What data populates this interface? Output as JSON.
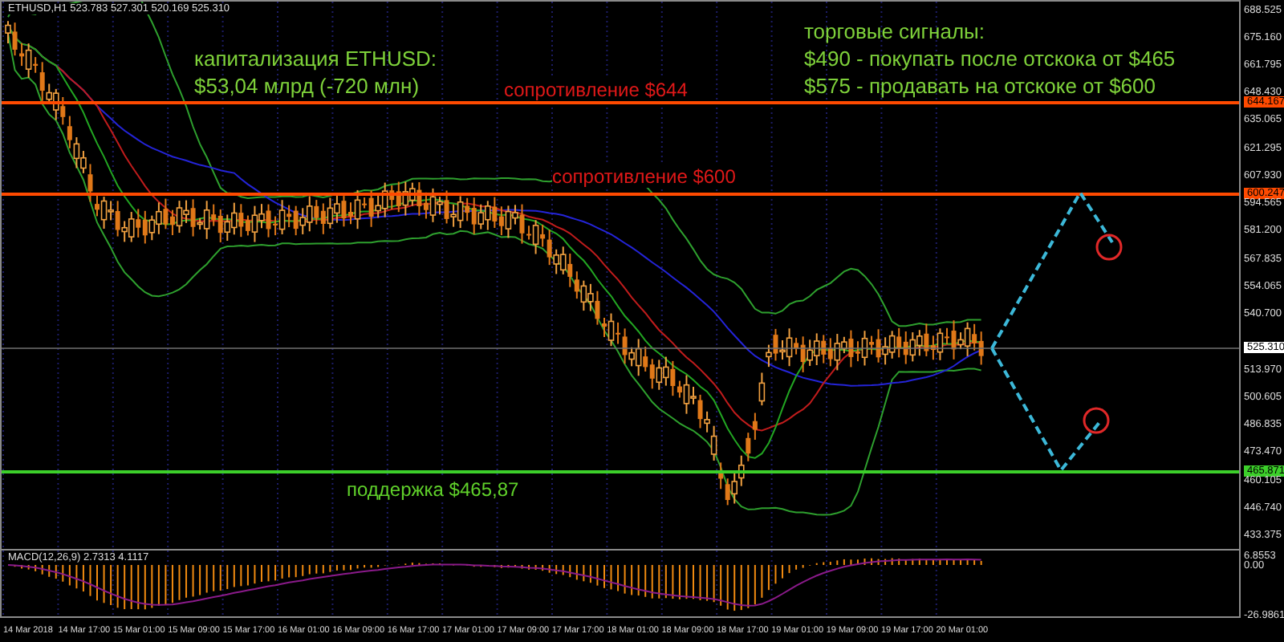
{
  "chart": {
    "title": "ETHUSD,H1 523.783 527.301 520.169 525.310"
  },
  "notes": [
    {
      "lines": [
        "капитализация ETHUSD:",
        "$53,04 млрд (-720 млн)"
      ]
    },
    {
      "lines": [
        "торговые сигналы:",
        "$490 - покупать после отскока от $465",
        "$575 - продавать на отскоке от $600"
      ]
    }
  ],
  "levels": [
    {
      "kind": "resistance",
      "label": "сопротивление $644",
      "price_tag": "644.167"
    },
    {
      "kind": "resistance",
      "label": "сопротивление $600",
      "price_tag": "600.247"
    },
    {
      "kind": "support",
      "label": "поддержка $465,87",
      "price_tag": "465.871"
    }
  ],
  "current_price_tag": "525.310",
  "price_axis": [
    "688.525",
    "675.160",
    "661.795",
    "648.430",
    "635.065",
    "621.295",
    "607.930",
    "594.565",
    "581.200",
    "567.835",
    "554.065",
    "540.700",
    "513.970",
    "500.605",
    "486.835",
    "473.470",
    "460.105",
    "446.740",
    "433.375"
  ],
  "indicator": {
    "title": "MACD(12,26,9) 2.7313 4.1117",
    "axis": [
      "6.8553",
      "0.00",
      "-26.9861"
    ]
  },
  "time_axis": [
    "14 Mar 2018",
    "14 Mar 17:00",
    "15 Mar 01:00",
    "15 Mar 09:00",
    "15 Mar 17:00",
    "16 Mar 01:00",
    "16 Mar 09:00",
    "16 Mar 17:00",
    "17 Mar 01:00",
    "17 Mar 09:00",
    "17 Mar 17:00",
    "18 Mar 01:00",
    "18 Mar 09:00",
    "18 Mar 17:00",
    "19 Mar 01:00",
    "19 Mar 09:00",
    "19 Mar 17:00",
    "20 Mar 01:00"
  ]
}
